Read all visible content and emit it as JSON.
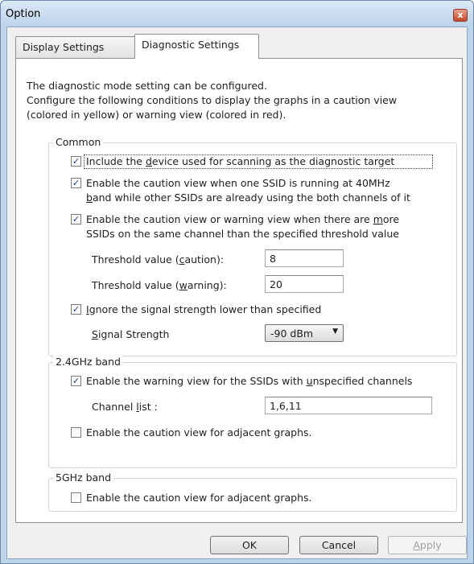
{
  "window": {
    "title": "Option",
    "close_glyph": "x"
  },
  "tabs": [
    {
      "label": "Display Settings"
    },
    {
      "label": "Diagnostic Settings"
    }
  ],
  "intro": [
    "The diagnostic mode setting can be configured.",
    "Configure the following conditions to display the graphs in a caution view",
    "(colored in yellow) or warning view (colored in red)."
  ],
  "common": {
    "label": "Common",
    "include_device": {
      "checked": true,
      "pre": "Include the ",
      "u": "d",
      "post": "evice used for scanning as the diagnostic target"
    },
    "caution_40mhz": {
      "checked": true,
      "line1": "Enable the caution view when one SSID is running at 40MHz",
      "l2_u": "b",
      "l2_post": "and while other SSIDs are already using the both channels of it"
    },
    "more_ssids": {
      "checked": true,
      "l1_pre": "Enable the caution view or warning view when there are ",
      "l1_u": "m",
      "l1_post": "ore",
      "line2": "SSIDs on the same channel than the specified threshold value"
    },
    "threshold_caution": {
      "pre": "Threshold value (",
      "u": "c",
      "post": "aution):",
      "value": "8"
    },
    "threshold_warning": {
      "pre": "Threshold value (",
      "u": "w",
      "post": "arning):",
      "value": "20"
    },
    "ignore_signal": {
      "checked": true,
      "u": "I",
      "post": "gnore the signal strength lower than specified"
    },
    "signal_strength": {
      "u": "S",
      "post": "ignal Strength",
      "value": "-90 dBm"
    }
  },
  "band24": {
    "label": "2.4GHz band",
    "warning_unspecified": {
      "checked": true,
      "pre": "Enable the warning view for the SSIDs with ",
      "u": "u",
      "post": "nspecified channels"
    },
    "channel_list": {
      "pre": "Channel ",
      "u": "l",
      "post": "ist :",
      "value": "1,6,11"
    },
    "adjacent": {
      "checked": false,
      "pre": "Enable the caution view for adjacent ",
      "u": "g",
      "post": "raphs."
    }
  },
  "band5": {
    "label": "5GHz band",
    "adjacent": {
      "checked": false,
      "pre": "Enable the caution view for adjacent ",
      "u": "g",
      "post": "raphs."
    }
  },
  "buttons": {
    "ok": "OK",
    "cancel": "Cancel",
    "apply_u": "A",
    "apply_post": "pply"
  }
}
